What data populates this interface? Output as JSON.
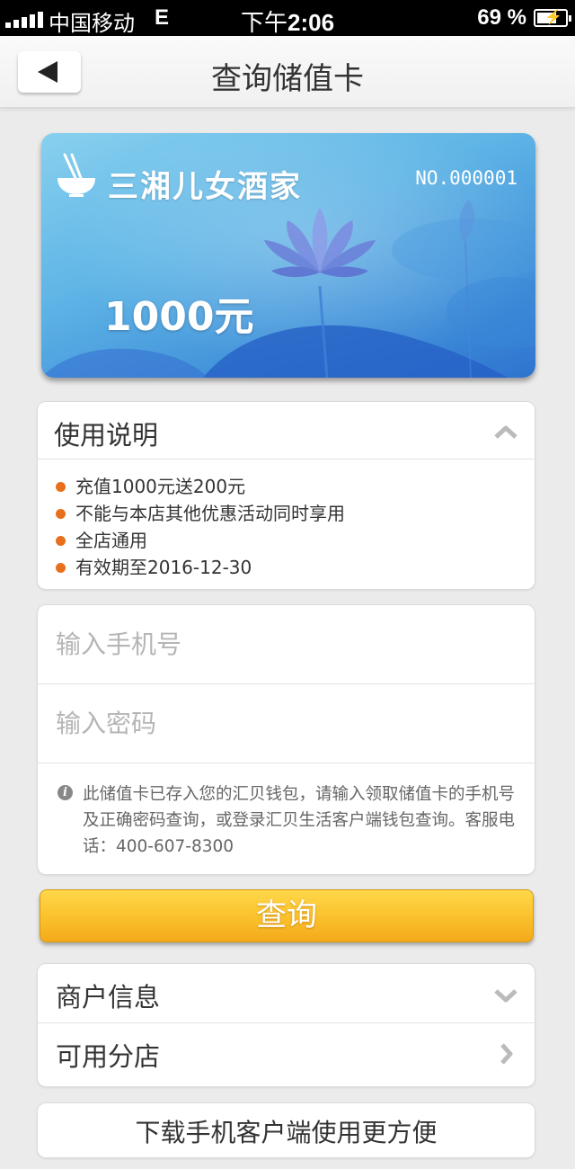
{
  "status_bar": {
    "carrier": "中国移动",
    "network": "E",
    "time_prefix": "下午",
    "time": "2:06",
    "battery": "69 %",
    "battery_level": 0.69
  },
  "nav": {
    "title": "查询储值卡",
    "back_icon": "back-arrow-icon"
  },
  "card": {
    "brand_name": "三湘儿女酒家",
    "number": "NO.000001",
    "amount": "1000元",
    "logo_icon": "bowl-chopsticks-icon",
    "colors": {
      "light": "#88d0ef",
      "dark": "#2f74d0"
    }
  },
  "usage": {
    "title": "使用说明",
    "toggle_icon": "chevron-up-icon",
    "items": [
      "充值1000元送200元",
      "不能与本店其他优惠活动同时享用",
      "全店通用",
      "有效期至2016-12-30"
    ],
    "bullet_color": "#e8701c"
  },
  "form": {
    "phone_placeholder": "输入手机号",
    "password_placeholder": "输入密码",
    "notice": "此储值卡已存入您的汇贝钱包，请输入领取储值卡的手机号及正确密码查询，或登录汇贝生活客户端钱包查询。客服电话：400-607-8300",
    "notice_icon": "info-icon"
  },
  "query_button": {
    "label": "查询",
    "color": "#fbc22e"
  },
  "merchant": {
    "info_label": "商户信息",
    "info_icon": "chevron-down-icon",
    "branches_label": "可用分店",
    "branches_icon": "chevron-right-icon"
  },
  "download": {
    "label": "下载手机客户端使用更方便"
  }
}
